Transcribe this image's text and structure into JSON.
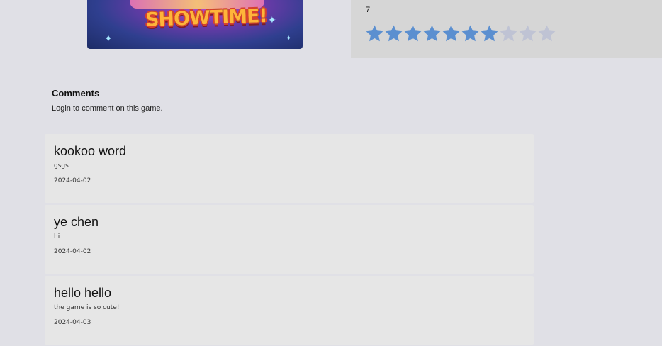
{
  "cover": {
    "logo_text": "SHOWTIME!"
  },
  "rating": {
    "value": "7",
    "stars_filled": 7,
    "stars_total": 10,
    "filled_color": "#5b8fd0",
    "empty_color": "#bfc3d4"
  },
  "comments_section": {
    "title": "Comments",
    "login_hint": "Login to comment on this game.",
    "items": [
      {
        "author": "kookoo word",
        "body": "gsgs",
        "date": "2024-04-02"
      },
      {
        "author": "ye chen",
        "body": "hi",
        "date": "2024-04-02"
      },
      {
        "author": "hello hello",
        "body": "the game is so cute!",
        "date": "2024-04-03"
      }
    ]
  }
}
